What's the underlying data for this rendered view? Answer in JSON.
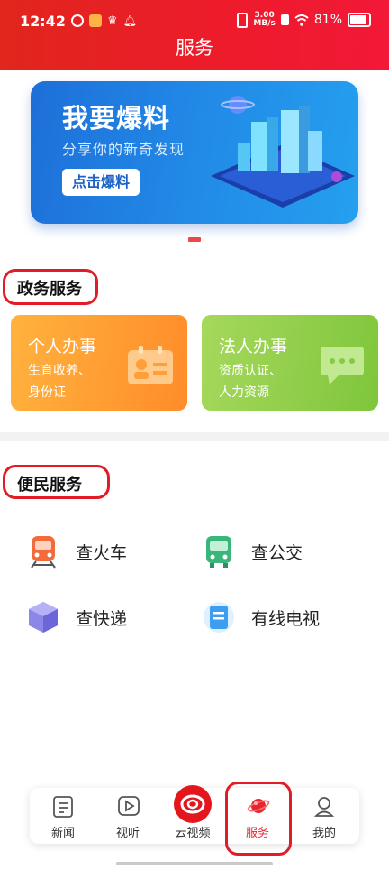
{
  "status_bar": {
    "time": "12:42",
    "net_speed_value": "3.00",
    "net_speed_unit": "MB/s",
    "battery": "81%"
  },
  "header": {
    "title": "服务"
  },
  "banner": {
    "title": "我要爆料",
    "subtitle": "分享你的新奇发现",
    "button": "点击爆料"
  },
  "carousel": {
    "page": 1,
    "total": 1
  },
  "gov_section": {
    "title": "政务服务",
    "cards": [
      {
        "title": "个人办事",
        "line1": "生育收养、",
        "line2": "身份证",
        "icon": "id-card-icon"
      },
      {
        "title": "法人办事",
        "line1": "资质认证、",
        "line2": "人力资源",
        "icon": "chat-bubble-icon"
      }
    ]
  },
  "convenience_section": {
    "title": "便民服务",
    "items": [
      {
        "label": "查火车",
        "icon": "train-icon"
      },
      {
        "label": "查公交",
        "icon": "bus-icon"
      },
      {
        "label": "查快递",
        "icon": "package-icon"
      },
      {
        "label": "有线电视",
        "icon": "cable-tv-icon"
      }
    ]
  },
  "bottom_nav": {
    "items": [
      {
        "label": "新闻",
        "icon": "news-icon"
      },
      {
        "label": "视听",
        "icon": "video-play-icon"
      },
      {
        "label": "云视频",
        "icon": "cloud-video-logo-icon"
      },
      {
        "label": "服务",
        "icon": "service-planet-icon",
        "active": true
      },
      {
        "label": "我的",
        "icon": "profile-icon"
      }
    ]
  },
  "colors": {
    "brand_red": "#e8242c",
    "orange_card": "#ff9a30",
    "green_card": "#8ccd46",
    "banner_blue": "#2187e6"
  }
}
